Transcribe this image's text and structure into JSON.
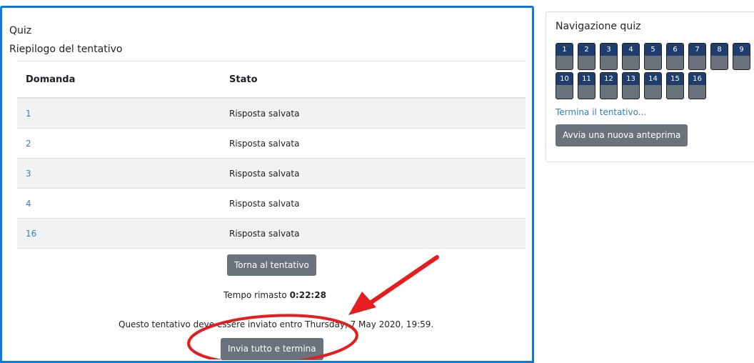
{
  "main": {
    "title": "Quiz",
    "summary_title": "Riepilogo del tentativo",
    "table": {
      "headers": [
        "Domanda",
        "Stato"
      ],
      "rows": [
        {
          "question": "1",
          "status": "Risposta salvata"
        },
        {
          "question": "2",
          "status": "Risposta salvata"
        },
        {
          "question": "3",
          "status": "Risposta salvata"
        },
        {
          "question": "4",
          "status": "Risposta salvata"
        },
        {
          "question": "16",
          "status": "Risposta salvata"
        }
      ]
    },
    "return_button": "Torna al tentativo",
    "time_left_label": "Tempo rimasto",
    "time_left_value": "0:22:28",
    "deadline_text": "Questo tentativo deve essere inviato entro Thursday, 7 May 2020, 19:59.",
    "submit_button": "Invia tutto e termina"
  },
  "nav": {
    "title": "Navigazione quiz",
    "buttons": [
      "1",
      "2",
      "3",
      "4",
      "5",
      "6",
      "7",
      "8",
      "9",
      "10",
      "11",
      "12",
      "13",
      "14",
      "15",
      "16"
    ],
    "finish_link": "Termina il tentativo...",
    "preview_button": "Avvia una nuova anteprima"
  },
  "colors": {
    "accent_border": "#0f7ad9",
    "button_gray": "#6a737b",
    "nav_number_bg": "#1f3e6e",
    "link": "#3a7bbf",
    "annotation_red": "#e41e1e"
  }
}
